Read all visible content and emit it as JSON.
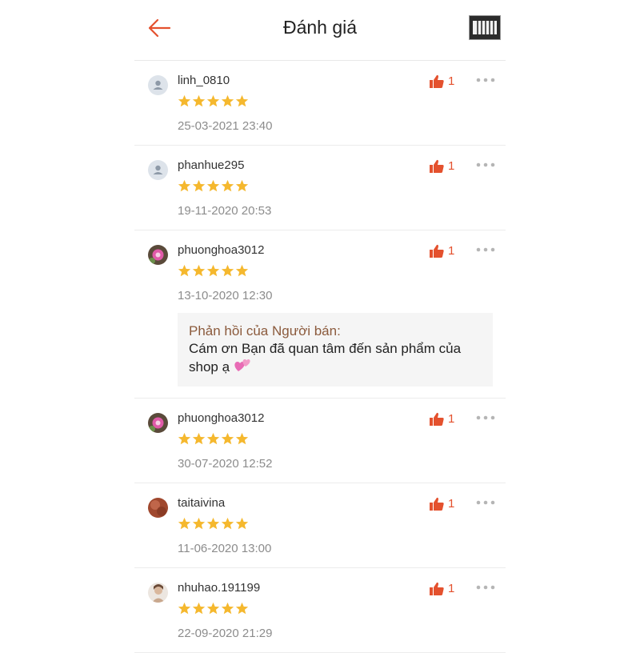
{
  "header": {
    "title": "Đánh giá",
    "back_icon": "arrow-left-icon",
    "accent": "#e4512e"
  },
  "colors": {
    "accent": "#e4512e",
    "star": "#f5b82e",
    "muted": "#8c8c8c",
    "seller_label": "#8b5a3c"
  },
  "reviews": [
    {
      "username": "linh_0810",
      "rating": 5,
      "likes": "1",
      "date": "25-03-2021 23:40",
      "avatar": "default-avatar"
    },
    {
      "username": "phanhue295",
      "rating": 5,
      "likes": "1",
      "date": "19-11-2020 20:53",
      "avatar": "default-avatar"
    },
    {
      "username": "phuonghoa3012",
      "rating": 5,
      "likes": "1",
      "date": "13-10-2020 12:30",
      "avatar": "flower-photo",
      "reply": {
        "label": "Phản hồi của Người bán:",
        "text": "Cám ơn Bạn đã quan tâm đến sản phẩm của shop ạ",
        "emoji": "two-hearts-icon"
      }
    },
    {
      "username": "phuonghoa3012",
      "rating": 5,
      "likes": "1",
      "date": "30-07-2020 12:52",
      "avatar": "flower-photo"
    },
    {
      "username": "taitaivina",
      "rating": 5,
      "likes": "1",
      "date": "11-06-2020 13:00",
      "avatar": "brown-photo"
    },
    {
      "username": "nhuhao.191199",
      "rating": 5,
      "likes": "1",
      "date": "22-09-2020 21:29",
      "avatar": "portrait-photo"
    }
  ]
}
